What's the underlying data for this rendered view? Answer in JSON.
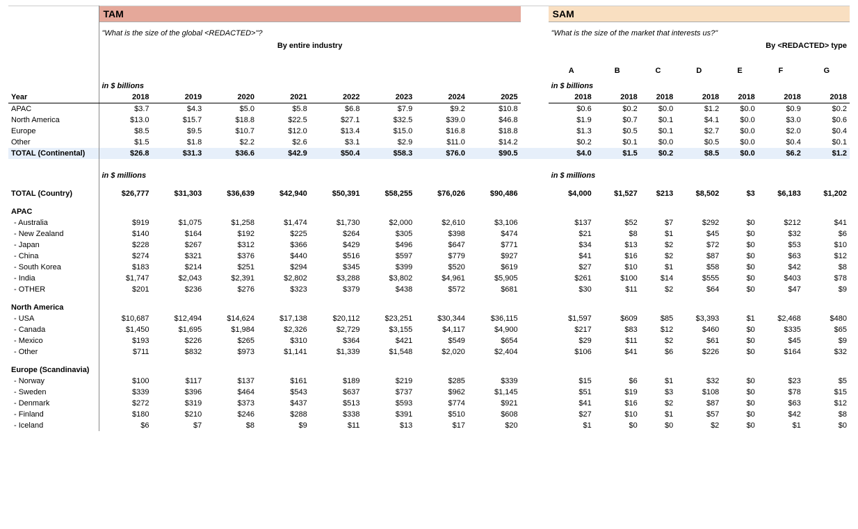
{
  "tam_title": "TAM",
  "sam_title": "SAM",
  "tam_question": "\"What is the size of the global <REDACTED>\"?",
  "sam_question": "\"What is the size of the market that interests us?\"",
  "tam_subheader": "By entire industry",
  "sam_subheader": "By <REDACTED> type",
  "sam_categories": [
    "A",
    "B",
    "C",
    "D",
    "E",
    "F",
    "G"
  ],
  "unit_billions": "in $ billions",
  "unit_millions": "in $ millions",
  "year_label": "Year",
  "tam_years": [
    "2018",
    "2019",
    "2020",
    "2021",
    "2022",
    "2023",
    "2024",
    "2025"
  ],
  "sam_years": [
    "2018",
    "2018",
    "2018",
    "2018",
    "2018",
    "2018",
    "2018"
  ],
  "continents": [
    {
      "name": "APAC",
      "tam": [
        "$3.7",
        "$4.3",
        "$5.0",
        "$5.8",
        "$6.8",
        "$7.9",
        "$9.2",
        "$10.8"
      ],
      "sam": [
        "$0.6",
        "$0.2",
        "$0.0",
        "$1.2",
        "$0.0",
        "$0.9",
        "$0.2"
      ]
    },
    {
      "name": "North America",
      "tam": [
        "$13.0",
        "$15.7",
        "$18.8",
        "$22.5",
        "$27.1",
        "$32.5",
        "$39.0",
        "$46.8"
      ],
      "sam": [
        "$1.9",
        "$0.7",
        "$0.1",
        "$4.1",
        "$0.0",
        "$3.0",
        "$0.6"
      ]
    },
    {
      "name": "Europe",
      "tam": [
        "$8.5",
        "$9.5",
        "$10.7",
        "$12.0",
        "$13.4",
        "$15.0",
        "$16.8",
        "$18.8"
      ],
      "sam": [
        "$1.3",
        "$0.5",
        "$0.1",
        "$2.7",
        "$0.0",
        "$2.0",
        "$0.4"
      ]
    },
    {
      "name": "Other",
      "tam": [
        "$1.5",
        "$1.8",
        "$2.2",
        "$2.6",
        "$3.1",
        "$2.9",
        "$11.0",
        "$14.2"
      ],
      "sam": [
        "$0.2",
        "$0.1",
        "$0.0",
        "$0.5",
        "$0.0",
        "$0.4",
        "$0.1"
      ]
    }
  ],
  "total_continental": {
    "name": "TOTAL (Continental)",
    "tam": [
      "$26.8",
      "$31.3",
      "$36.6",
      "$42.9",
      "$50.4",
      "$58.3",
      "$76.0",
      "$90.5"
    ],
    "sam": [
      "$4.0",
      "$1.5",
      "$0.2",
      "$8.5",
      "$0.0",
      "$6.2",
      "$1.2"
    ]
  },
  "total_country": {
    "name": "TOTAL (Country)",
    "tam": [
      "$26,777",
      "$31,303",
      "$36,639",
      "$42,940",
      "$50,391",
      "$58,255",
      "$76,026",
      "$90,486"
    ],
    "sam": [
      "$4,000",
      "$1,527",
      "$213",
      "$8,502",
      "$3",
      "$6,183",
      "$1,202"
    ]
  },
  "regions": [
    {
      "name": "APAC",
      "rows": [
        {
          "name": " - Australia",
          "tam": [
            "$919",
            "$1,075",
            "$1,258",
            "$1,474",
            "$1,730",
            "$2,000",
            "$2,610",
            "$3,106"
          ],
          "sam": [
            "$137",
            "$52",
            "$7",
            "$292",
            "$0",
            "$212",
            "$41"
          ]
        },
        {
          "name": " - New Zealand",
          "tam": [
            "$140",
            "$164",
            "$192",
            "$225",
            "$264",
            "$305",
            "$398",
            "$474"
          ],
          "sam": [
            "$21",
            "$8",
            "$1",
            "$45",
            "$0",
            "$32",
            "$6"
          ]
        },
        {
          "name": " - Japan",
          "tam": [
            "$228",
            "$267",
            "$312",
            "$366",
            "$429",
            "$496",
            "$647",
            "$771"
          ],
          "sam": [
            "$34",
            "$13",
            "$2",
            "$72",
            "$0",
            "$53",
            "$10"
          ]
        },
        {
          "name": " - China",
          "tam": [
            "$274",
            "$321",
            "$376",
            "$440",
            "$516",
            "$597",
            "$779",
            "$927"
          ],
          "sam": [
            "$41",
            "$16",
            "$2",
            "$87",
            "$0",
            "$63",
            "$12"
          ]
        },
        {
          "name": " - South Korea",
          "tam": [
            "$183",
            "$214",
            "$251",
            "$294",
            "$345",
            "$399",
            "$520",
            "$619"
          ],
          "sam": [
            "$27",
            "$10",
            "$1",
            "$58",
            "$0",
            "$42",
            "$8"
          ]
        },
        {
          "name": " - India",
          "tam": [
            "$1,747",
            "$2,043",
            "$2,391",
            "$2,802",
            "$3,288",
            "$3,802",
            "$4,961",
            "$5,905"
          ],
          "sam": [
            "$261",
            "$100",
            "$14",
            "$555",
            "$0",
            "$403",
            "$78"
          ]
        },
        {
          "name": " - OTHER",
          "tam": [
            "$201",
            "$236",
            "$276",
            "$323",
            "$379",
            "$438",
            "$572",
            "$681"
          ],
          "sam": [
            "$30",
            "$11",
            "$2",
            "$64",
            "$0",
            "$47",
            "$9"
          ]
        }
      ]
    },
    {
      "name": "North America",
      "rows": [
        {
          "name": " - USA",
          "tam": [
            "$10,687",
            "$12,494",
            "$14,624",
            "$17,138",
            "$20,112",
            "$23,251",
            "$30,344",
            "$36,115"
          ],
          "sam": [
            "$1,597",
            "$609",
            "$85",
            "$3,393",
            "$1",
            "$2,468",
            "$480"
          ]
        },
        {
          "name": " - Canada",
          "tam": [
            "$1,450",
            "$1,695",
            "$1,984",
            "$2,326",
            "$2,729",
            "$3,155",
            "$4,117",
            "$4,900"
          ],
          "sam": [
            "$217",
            "$83",
            "$12",
            "$460",
            "$0",
            "$335",
            "$65"
          ]
        },
        {
          "name": " - Mexico",
          "tam": [
            "$193",
            "$226",
            "$265",
            "$310",
            "$364",
            "$421",
            "$549",
            "$654"
          ],
          "sam": [
            "$29",
            "$11",
            "$2",
            "$61",
            "$0",
            "$45",
            "$9"
          ]
        },
        {
          "name": " - Other",
          "tam": [
            "$711",
            "$832",
            "$973",
            "$1,141",
            "$1,339",
            "$1,548",
            "$2,020",
            "$2,404"
          ],
          "sam": [
            "$106",
            "$41",
            "$6",
            "$226",
            "$0",
            "$164",
            "$32"
          ]
        }
      ]
    },
    {
      "name": "Europe (Scandinavia)",
      "rows": [
        {
          "name": " - Norway",
          "tam": [
            "$100",
            "$117",
            "$137",
            "$161",
            "$189",
            "$219",
            "$285",
            "$339"
          ],
          "sam": [
            "$15",
            "$6",
            "$1",
            "$32",
            "$0",
            "$23",
            "$5"
          ]
        },
        {
          "name": " - Sweden",
          "tam": [
            "$339",
            "$396",
            "$464",
            "$543",
            "$637",
            "$737",
            "$962",
            "$1,145"
          ],
          "sam": [
            "$51",
            "$19",
            "$3",
            "$108",
            "$0",
            "$78",
            "$15"
          ]
        },
        {
          "name": " - Denmark",
          "tam": [
            "$272",
            "$319",
            "$373",
            "$437",
            "$513",
            "$593",
            "$774",
            "$921"
          ],
          "sam": [
            "$41",
            "$16",
            "$2",
            "$87",
            "$0",
            "$63",
            "$12"
          ]
        },
        {
          "name": " - Finland",
          "tam": [
            "$180",
            "$210",
            "$246",
            "$288",
            "$338",
            "$391",
            "$510",
            "$608"
          ],
          "sam": [
            "$27",
            "$10",
            "$1",
            "$57",
            "$0",
            "$42",
            "$8"
          ]
        },
        {
          "name": " - Iceland",
          "tam": [
            "$6",
            "$7",
            "$8",
            "$9",
            "$11",
            "$13",
            "$17",
            "$20"
          ],
          "sam": [
            "$1",
            "$0",
            "$0",
            "$2",
            "$0",
            "$1",
            "$0"
          ]
        }
      ]
    }
  ]
}
